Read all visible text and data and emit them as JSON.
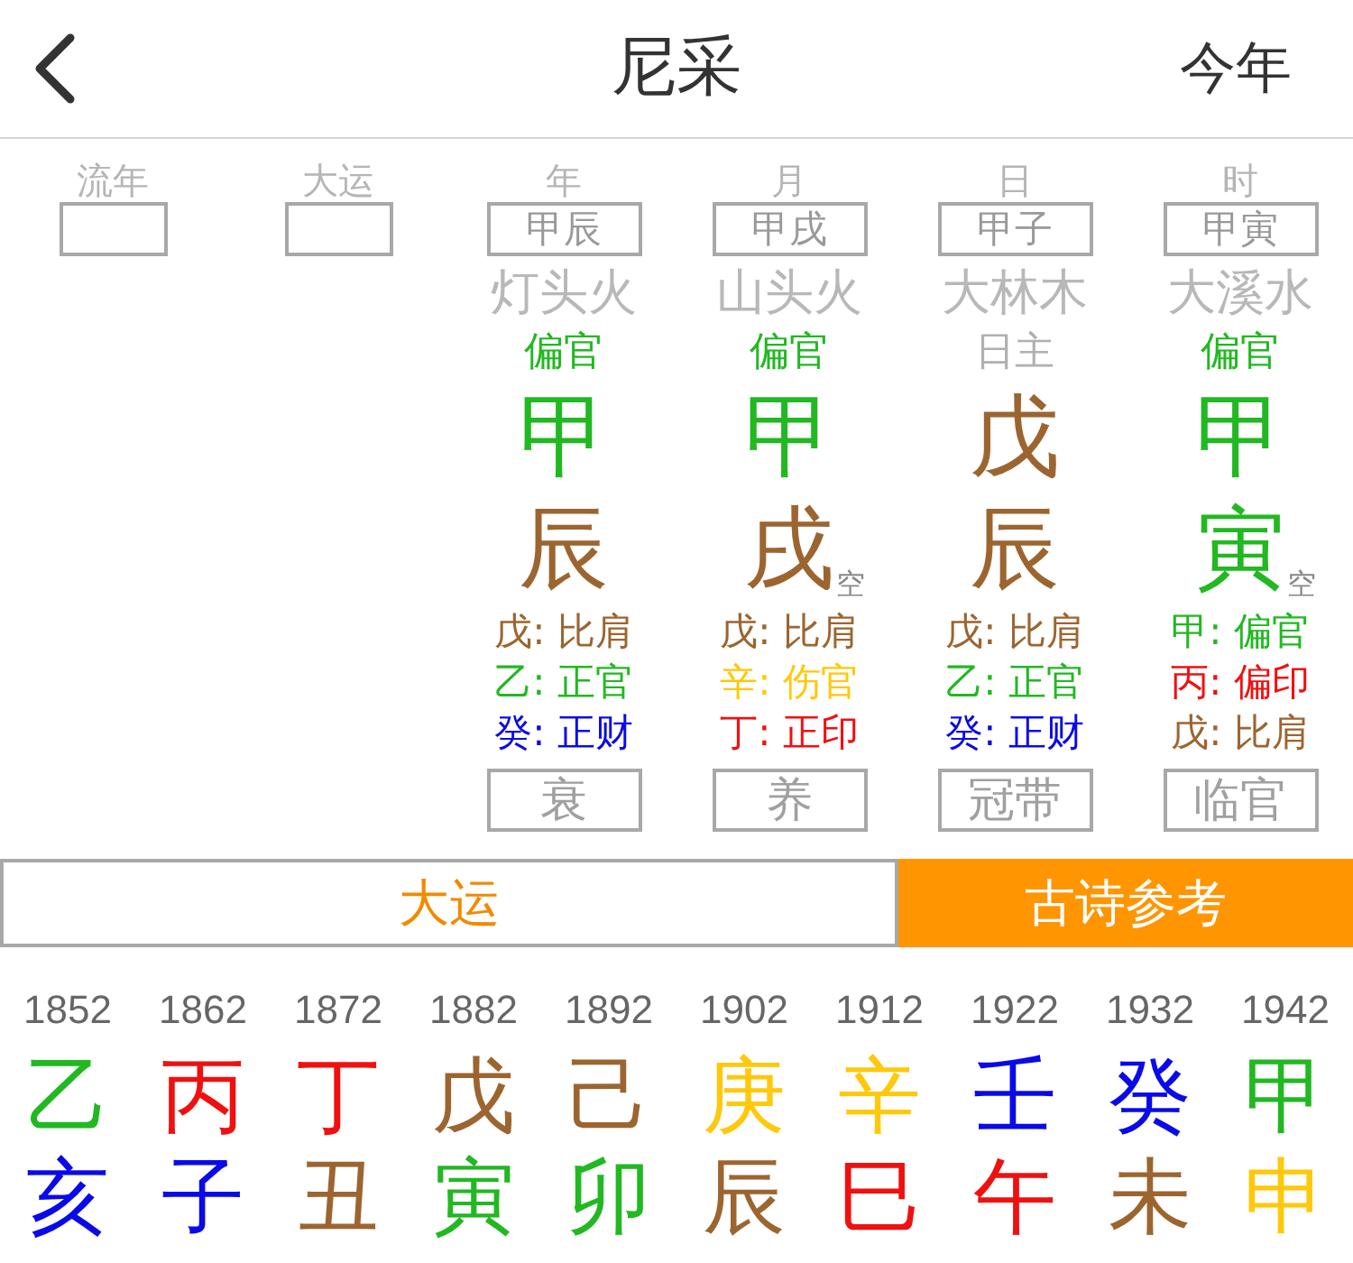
{
  "header": {
    "title": "尼采",
    "action": "今年"
  },
  "columns": [
    {
      "kind": "empty",
      "label": "流年"
    },
    {
      "kind": "empty",
      "label": "大运"
    },
    {
      "kind": "pillar",
      "label": "年",
      "ganzhi": "甲辰",
      "nayin": "灯头火",
      "ten_god": {
        "text": "偏官",
        "color": "#22b822"
      },
      "stem": {
        "text": "甲",
        "color": "#22b822"
      },
      "branch": {
        "text": "辰",
        "color": "#9c6530"
      },
      "hidden": [
        {
          "text": "戊: 比肩",
          "color": "#9c6530"
        },
        {
          "text": "乙: 正官",
          "color": "#22b822"
        },
        {
          "text": "癸: 正财",
          "color": "#0a0ae8"
        }
      ],
      "stage": "衰"
    },
    {
      "kind": "pillar",
      "label": "月",
      "ganzhi": "甲戌",
      "nayin": "山头火",
      "ten_god": {
        "text": "偏官",
        "color": "#22b822"
      },
      "stem": {
        "text": "甲",
        "color": "#22b822"
      },
      "branch": {
        "text": "戌",
        "color": "#9c6530",
        "note": "空"
      },
      "hidden": [
        {
          "text": "戊: 比肩",
          "color": "#9c6530"
        },
        {
          "text": "辛: 伤官",
          "color": "#ffc80a"
        },
        {
          "text": "丁: 正印",
          "color": "#f01010"
        }
      ],
      "stage": "养"
    },
    {
      "kind": "pillar",
      "label": "日",
      "ganzhi": "甲子",
      "nayin": "大林木",
      "ten_god": {
        "text": "日主",
        "color": "#b0b0b0"
      },
      "stem": {
        "text": "戊",
        "color": "#9c6530"
      },
      "branch": {
        "text": "辰",
        "color": "#9c6530"
      },
      "hidden": [
        {
          "text": "戊: 比肩",
          "color": "#9c6530"
        },
        {
          "text": "乙: 正官",
          "color": "#22b822"
        },
        {
          "text": "癸: 正财",
          "color": "#0a0ae8"
        }
      ],
      "stage": "冠带"
    },
    {
      "kind": "pillar",
      "label": "时",
      "ganzhi": "甲寅",
      "nayin": "大溪水",
      "ten_god": {
        "text": "偏官",
        "color": "#22b822"
      },
      "stem": {
        "text": "甲",
        "color": "#22b822"
      },
      "branch": {
        "text": "寅",
        "color": "#22b822",
        "note": "空"
      },
      "hidden": [
        {
          "text": "甲: 偏官",
          "color": "#22b822"
        },
        {
          "text": "丙: 偏印",
          "color": "#f01010"
        },
        {
          "text": "戊: 比肩",
          "color": "#9c6530"
        }
      ],
      "stage": "临官"
    }
  ],
  "tabs": [
    {
      "label": "大运",
      "selected": false
    },
    {
      "label": "古诗参考",
      "selected": true
    }
  ],
  "dayun": [
    {
      "year": "1852",
      "stem": {
        "text": "乙",
        "color": "#22b822"
      },
      "branch": {
        "text": "亥",
        "color": "#0a0ae8"
      }
    },
    {
      "year": "1862",
      "stem": {
        "text": "丙",
        "color": "#f01010"
      },
      "branch": {
        "text": "子",
        "color": "#0a0ae8"
      }
    },
    {
      "year": "1872",
      "stem": {
        "text": "丁",
        "color": "#f01010"
      },
      "branch": {
        "text": "丑",
        "color": "#9c6530"
      }
    },
    {
      "year": "1882",
      "stem": {
        "text": "戊",
        "color": "#9c6530"
      },
      "branch": {
        "text": "寅",
        "color": "#22b822"
      }
    },
    {
      "year": "1892",
      "stem": {
        "text": "己",
        "color": "#9c6530"
      },
      "branch": {
        "text": "卯",
        "color": "#22b822"
      }
    },
    {
      "year": "1902",
      "stem": {
        "text": "庚",
        "color": "#ffc80a"
      },
      "branch": {
        "text": "辰",
        "color": "#9c6530"
      }
    },
    {
      "year": "1912",
      "stem": {
        "text": "辛",
        "color": "#ffc80a"
      },
      "branch": {
        "text": "巳",
        "color": "#f01010"
      }
    },
    {
      "year": "1922",
      "stem": {
        "text": "壬",
        "color": "#0a0ae8"
      },
      "branch": {
        "text": "午",
        "color": "#f01010"
      }
    },
    {
      "year": "1932",
      "stem": {
        "text": "癸",
        "color": "#0a0ae8"
      },
      "branch": {
        "text": "未",
        "color": "#9c6530"
      }
    },
    {
      "year": "1942",
      "stem": {
        "text": "甲",
        "color": "#22b822"
      },
      "branch": {
        "text": "申",
        "color": "#ffc80a"
      }
    }
  ]
}
